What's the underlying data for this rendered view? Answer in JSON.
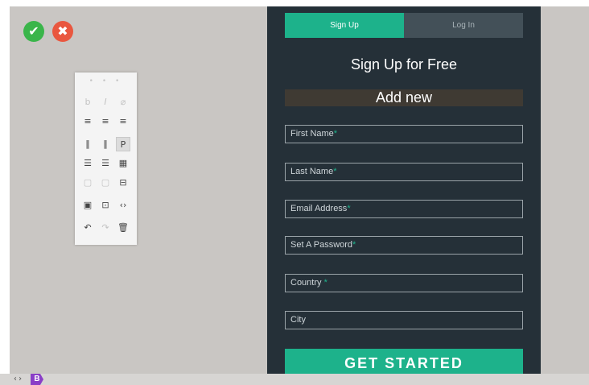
{
  "actions": {
    "confirm_icon": "✔",
    "cancel_icon": "✖"
  },
  "toolbar": {
    "handle": "• • •",
    "rows": [
      [
        "b",
        "I",
        "⌀"
      ],
      [
        "≡",
        "≡",
        "≡"
      ],
      [
        "‖",
        "‖",
        "P"
      ],
      [
        "☰",
        "☰",
        "▦"
      ],
      [
        "▢",
        "▢",
        "⊟"
      ],
      [
        "▣",
        "⊡",
        "‹›"
      ],
      [
        "↶",
        "↷",
        "🗑"
      ]
    ]
  },
  "form": {
    "tabs": {
      "signup": "Sign Up",
      "login": "Log In"
    },
    "heading": "Sign Up for Free",
    "add_new": "Add new",
    "fields": [
      {
        "label": "First Name",
        "required": "*"
      },
      {
        "label": "Last Name",
        "required": "*"
      },
      {
        "label": "Email Address",
        "required": "*"
      },
      {
        "label": "Set A Password",
        "required": "*"
      },
      {
        "label": "Country ",
        "required": "*"
      },
      {
        "label": "City",
        "required": ""
      }
    ],
    "submit": "GET STARTED"
  },
  "bottom": {
    "code": "‹›",
    "badge": "B"
  },
  "colors": {
    "accent": "#1db28b",
    "panel": "#253038",
    "confirm": "#3ab54a",
    "cancel": "#e9573f"
  }
}
